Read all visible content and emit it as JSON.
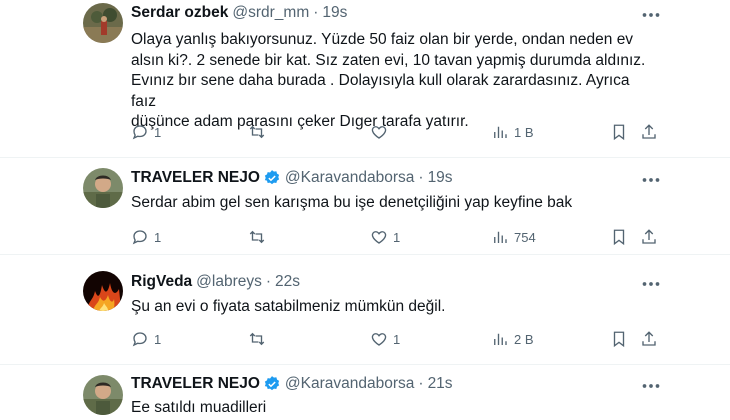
{
  "tweets": [
    {
      "name": "Serdar ozbek",
      "verified": false,
      "handle": "@srdr_mm",
      "time": "19s",
      "lines": [
        "Olaya yanlış bakıyorsunuz. Yüzde 50 faiz olan bir yerde, ondan neden ev",
        "alsın ki?.  2 senede bir kat. Sız zaten evi, 10 tavan yapmiş durumda aldınız.",
        "Evınız bır sene daha burada . Dolayısıyla kull olarak zarardasınız. Ayrıca faız",
        "düşünce adam parasını çeker Dıger tarafa yatırır."
      ],
      "replies": "1",
      "retweets": "",
      "likes": "",
      "views": "1 B"
    },
    {
      "name": "TRAVELER NEJO",
      "verified": true,
      "handle": "@Karavandaborsa",
      "time": "19s",
      "lines": [
        "Serdar abim gel sen karışma bu işe denetçiliğini yap keyfine bak"
      ],
      "replies": "1",
      "retweets": "",
      "likes": "1",
      "views": "754"
    },
    {
      "name": "RigVeda",
      "verified": false,
      "handle": "@labreys",
      "time": "22s",
      "lines": [
        "Şu an evi o fiyata satabilmeniz mümkün değil."
      ],
      "replies": "1",
      "retweets": "",
      "likes": "1",
      "views": "2 B"
    },
    {
      "name": "TRAVELER NEJO",
      "verified": true,
      "handle": "@Karavandaborsa",
      "time": "21s",
      "lines": [
        "Ee satıldı muadilleri"
      ],
      "replies": "",
      "retweets": "",
      "likes": "",
      "views": ""
    }
  ],
  "separator": "·",
  "colors": {
    "text": "#0f1419",
    "secondary": "#536471",
    "verified": "#1d9bf0",
    "divider": "#eff3f4"
  }
}
